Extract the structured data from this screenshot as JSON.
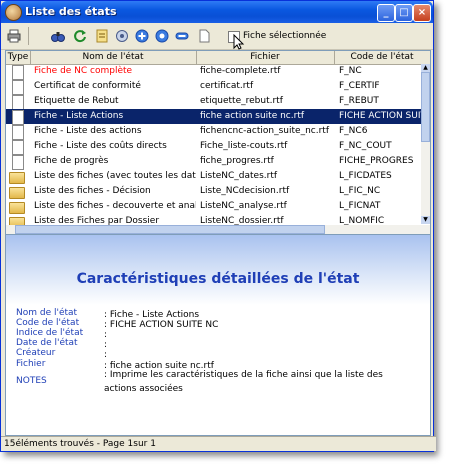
{
  "window": {
    "title": "Liste des états"
  },
  "toolbar": {
    "checkbox_label": "Fiche sélectionnée"
  },
  "table": {
    "headers": [
      "Type",
      "Nom de l'état",
      "Fichier",
      "Code de l'état"
    ],
    "rows": [
      {
        "icon": "document-icon",
        "nom": "Fiche de NC complète",
        "fichier": "fiche-complete.rtf",
        "code": "F_NC"
      },
      {
        "icon": "document-icon",
        "nom": "Certificat de conformité",
        "fichier": "certificat.rtf",
        "code": "F_CERTIF"
      },
      {
        "icon": "document-icon",
        "nom": "Etiquette de Rebut",
        "fichier": "etiquette_rebut.rtf",
        "code": "F_REBUT"
      },
      {
        "icon": "document-icon",
        "nom": "Fiche - Liste Actions",
        "fichier": "fiche action suite nc.rtf",
        "code": "FICHE ACTION SUITE NC"
      },
      {
        "icon": "document-icon",
        "nom": "Fiche - Liste des actions",
        "fichier": "fichencnc-action_suite_nc.rtf",
        "code": "F_NC6"
      },
      {
        "icon": "document-icon",
        "nom": "Fiche - Liste des coûts directs",
        "fichier": "Fiche_liste-couts.rtf",
        "code": "F_NC_COUT"
      },
      {
        "icon": "document-icon",
        "nom": "Fiche de progrès",
        "fichier": "fiche_progres.rtf",
        "code": "FICHE_PROGRES"
      },
      {
        "icon": "folder-icon",
        "nom": "Liste des fiches (avec toutes les dates)",
        "fichier": "ListeNC_dates.rtf",
        "code": "L_FICDATES"
      },
      {
        "icon": "folder-icon",
        "nom": "Liste des fiches - Décision",
        "fichier": "Liste_NCdecision.rtf",
        "code": "L_FIC_NC"
      },
      {
        "icon": "folder-icon",
        "nom": "Liste des fiches - decouverte et analyse",
        "fichier": "ListeNC_analyse.rtf",
        "code": "L_FICNAT"
      },
      {
        "icon": "folder-icon",
        "nom": "Liste des Fiches par Dossier",
        "fichier": "ListeNC_dossier.rtf",
        "code": "L_NOMFIC"
      }
    ]
  },
  "detail": {
    "title": "Caractéristiques détaillées de l'état",
    "fields": [
      {
        "label": "Nom de l'état",
        "value": ": Fiche - Liste Actions"
      },
      {
        "label": "Code de l'état",
        "value": ": FICHE ACTION SUITE NC"
      },
      {
        "label": "Indice de l'état",
        "value": ":"
      },
      {
        "label": "Date de l'état",
        "value": ":"
      },
      {
        "label": "Créateur",
        "value": ":"
      },
      {
        "label": "Fichier",
        "value": ": fiche action suite nc.rtf"
      },
      {
        "label": "NOTES",
        "value": ": Imprime les caractéristiques de la fiche ainsi que la liste des actions associées"
      }
    ]
  },
  "status": {
    "text": "15éléments trouvés - Page 1sur 1"
  },
  "colors": {
    "accent": "#1f3fb6",
    "selection": "#0a246a",
    "first_row_text": "#ff0000"
  }
}
